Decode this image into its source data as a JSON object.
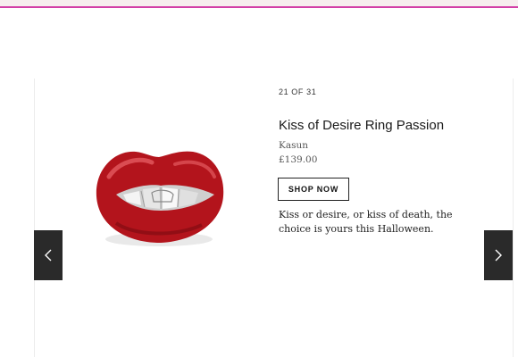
{
  "colors": {
    "accent": "#d23fa6",
    "nav_bg": "#2a2a2a",
    "lip_red": "#b3141c"
  },
  "product": {
    "counter": "21 OF 31",
    "title": "Kiss of Desire Ring Passion",
    "brand": "Kasun",
    "price": "£139.00",
    "shop_label": "SHOP NOW",
    "description": "Kiss or desire, or kiss of death, the choice is yours this Halloween."
  },
  "icons": {
    "prev": "chevron-left-icon",
    "next": "chevron-right-icon"
  }
}
